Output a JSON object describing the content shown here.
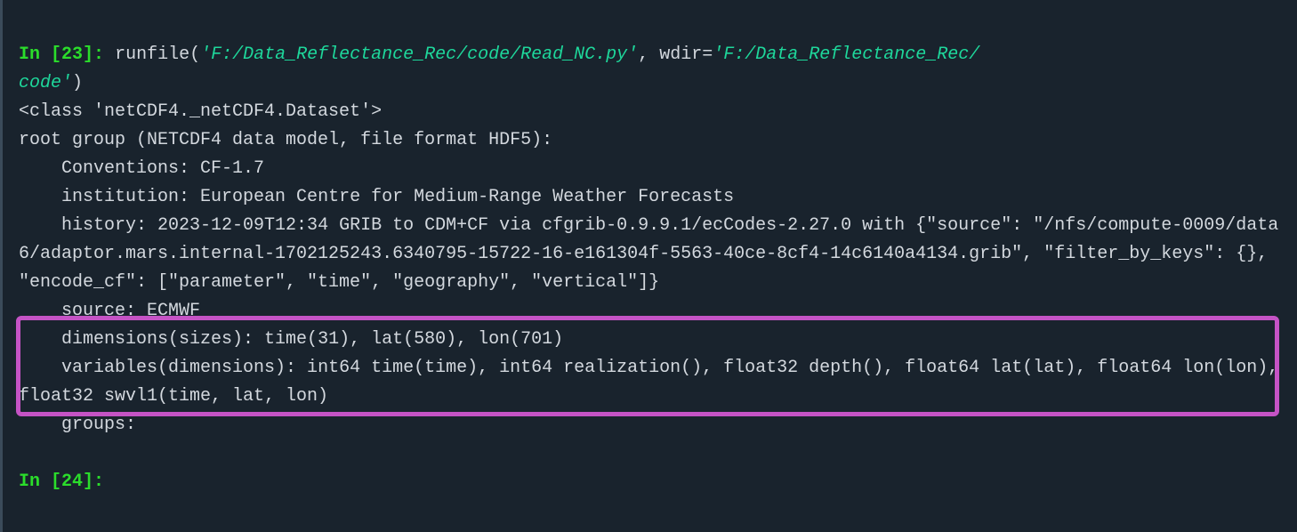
{
  "prompts": {
    "in_label": "In [",
    "close": "]:",
    "num1": "23",
    "num2": "24"
  },
  "cmd": {
    "fn": "runfile",
    "arg1": "'F:/Data_Reflectance_Rec/code/Read_NC.py'",
    "wdir_kw": "wdir",
    "eq": "=",
    "arg2_a": "'F:/Data_Reflectance_Rec/",
    "arg2_b": "code'"
  },
  "out": {
    "l1": "<class 'netCDF4._netCDF4.Dataset'>",
    "l2": "root group (NETCDF4 data model, file format HDF5):",
    "l3": "    Conventions: CF-1.7",
    "l4": "    institution: European Centre for Medium-Range Weather Forecasts",
    "l5": "    history: 2023-12-09T12:34 GRIB to CDM+CF via cfgrib-0.9.9.1/ecCodes-2.27.0 with {\"source\": \"/nfs/compute-0009/data6/adaptor.mars.internal-1702125243.6340795-15722-16-e161304f-5563-40ce-8cf4-14c6140a4134.grib\", \"filter_by_keys\": {}, \"encode_cf\": [\"parameter\", \"time\", \"geography\", \"vertical\"]}",
    "l6": "    source: ECMWF",
    "l7": "    dimensions(sizes): time(31), lat(580), lon(701)",
    "l8": "    variables(dimensions): int64 time(time), int64 realization(), float32 depth(), float64 lat(lat), float64 lon(lon), float32 swvl1(time, lat, lon)",
    "l9": "    groups:"
  }
}
